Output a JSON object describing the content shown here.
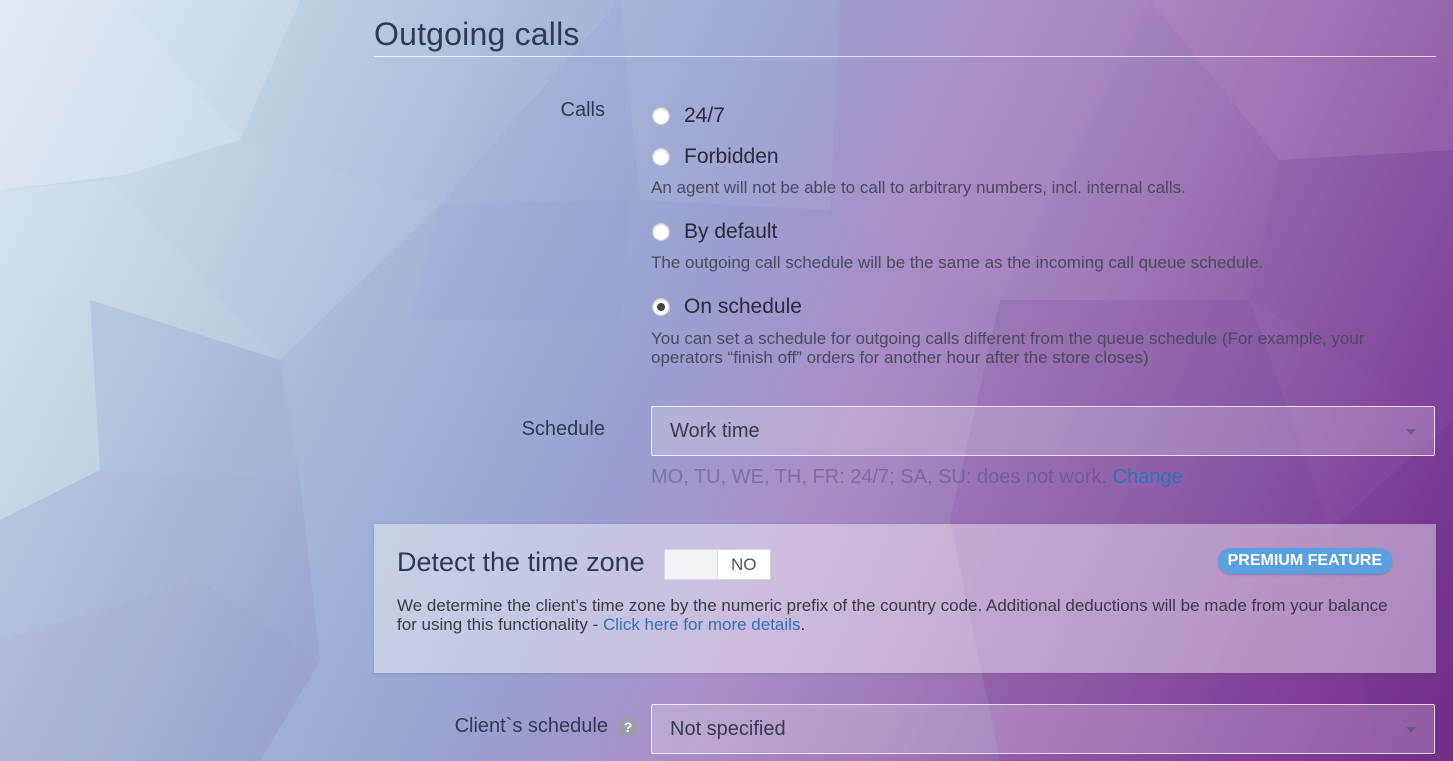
{
  "section": {
    "title": "Outgoing calls"
  },
  "calls": {
    "label": "Calls",
    "options": [
      {
        "label": "24/7",
        "checked": false,
        "hint": ""
      },
      {
        "label": "Forbidden",
        "checked": false,
        "hint": "An agent will not be able to call to arbitrary numbers, incl. internal calls."
      },
      {
        "label": "By default",
        "checked": false,
        "hint": "The outgoing call schedule will be the same as the incoming call queue schedule."
      },
      {
        "label": "On schedule",
        "checked": true,
        "hint": "You can set a schedule for outgoing calls different from the queue schedule (For example, your operators “finish off” orders for another hour after the store closes)"
      }
    ]
  },
  "schedule": {
    "label": "Schedule",
    "value": "Work time",
    "info": "MO, TU, WE, TH, FR: 24/7; SA, SU: does not work.",
    "change_link": "Change"
  },
  "timezone": {
    "title": "Detect the time zone",
    "toggle_state": "NO",
    "badge": "PREMIUM FEATURE",
    "text": "We determine the client’s time zone by the numeric prefix of the country code. Additional deductions will be made from your balance for using this functionality - ",
    "link": "Click here for more details",
    "text_end": "."
  },
  "client_schedule": {
    "label": "Client`s schedule",
    "help": "?",
    "value": "Not specified"
  },
  "colors": {
    "accent_link": "#2f72b6",
    "badge": "#5aa0e0"
  }
}
